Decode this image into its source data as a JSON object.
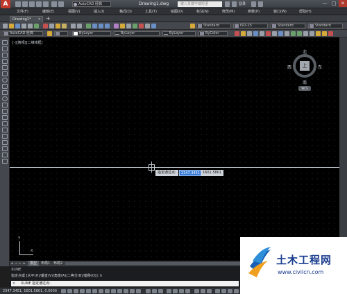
{
  "titlebar": {
    "workspace": "AutoCAD 经典",
    "doc_title": "Drawing1.dwg",
    "search_placeholder": "键入关键字或短语",
    "login": "登录",
    "win_min": "—",
    "win_max": "□",
    "win_close": "✕"
  },
  "menu": [
    "文件(F)",
    "编辑(E)",
    "视图(V)",
    "插入(I)",
    "格式(O)",
    "工具(T)",
    "绘图(D)",
    "标注(N)",
    "修改(M)",
    "参数(P)",
    "窗口(W)",
    "帮助(H)"
  ],
  "doc_tab": {
    "label": "Drawing1*",
    "close": "×",
    "new_tab": "+"
  },
  "toolbar1": {
    "text_style": "Standard",
    "dim_style": "ISO-25",
    "table_style": "Standard",
    "mleader_style": "Standard"
  },
  "toolbar2": {
    "workspace": "AutoCAD 经典",
    "color": "ByLayer",
    "linetype": "ByLayer",
    "lineweight": "ByLayer",
    "plotstyle": "ByColor"
  },
  "canvas": {
    "viewport_label": "[-][俯视][二维线框]",
    "dyn_prompt": "指定通过点:",
    "dyn_x": "2347.3451",
    "dyn_y": "1601.5801"
  },
  "viewcube": {
    "north": "北",
    "south": "南",
    "east": "东",
    "west": "西",
    "face": "上",
    "wcs": "WCS"
  },
  "ucs": {
    "x": "X",
    "y": "Y"
  },
  "layout_tabs": {
    "model": "模型",
    "layout1": "布局1",
    "layout2": "布局2"
  },
  "command": {
    "line1": "XLINE",
    "line2": "指定点或 [水平(H)/垂直(V)/角度(A)/二等分(B)/偏移(O)]: h",
    "input": "XLINE 指定通过点:"
  },
  "status": {
    "coords": "2347.3451, 1601.5801, 0.0000"
  },
  "watermark": {
    "title": "土木工程网",
    "url": "www.civilcn.com"
  }
}
